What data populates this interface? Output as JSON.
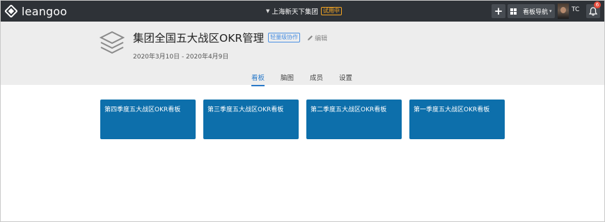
{
  "app": {
    "logo_text": "leangoo"
  },
  "topbar": {
    "org_name": "上海新天下集团",
    "trial_label": "试用中",
    "add_label": "+",
    "board_nav_label": "看板导航",
    "user_initials": "TC",
    "notification_count": "6"
  },
  "project": {
    "title": "集团全国五大战区OKR管理",
    "badge": "轻量级协作",
    "edit_label": "编辑",
    "date_range": "2020年3月10日 - 2020年4月9日"
  },
  "tabs": [
    {
      "label": "看板",
      "active": true
    },
    {
      "label": "脑图",
      "active": false
    },
    {
      "label": "成员",
      "active": false
    },
    {
      "label": "设置",
      "active": false
    }
  ],
  "boards": [
    {
      "title": "第四季度五大战区OKR看板"
    },
    {
      "title": "第三季度五大战区OKR看板"
    },
    {
      "title": "第二季度五大战区OKR看板"
    },
    {
      "title": "第一季度五大战区OKR看板"
    }
  ],
  "colors": {
    "topbar": "#2e3237",
    "header_bg": "#ededed",
    "board_card": "#0d6fab",
    "active_tab": "#2a7ac9",
    "trial_badge": "#f5a623",
    "project_badge": "#4a90e2",
    "notification": "#e74c3c"
  },
  "icons": {
    "logo": "leangoo-logo-icon",
    "project": "stack-layers-icon",
    "edit": "pencil-icon",
    "board_nav": "grid-icon",
    "notifications": "bell-icon",
    "dropdown": "caret-down-icon"
  }
}
